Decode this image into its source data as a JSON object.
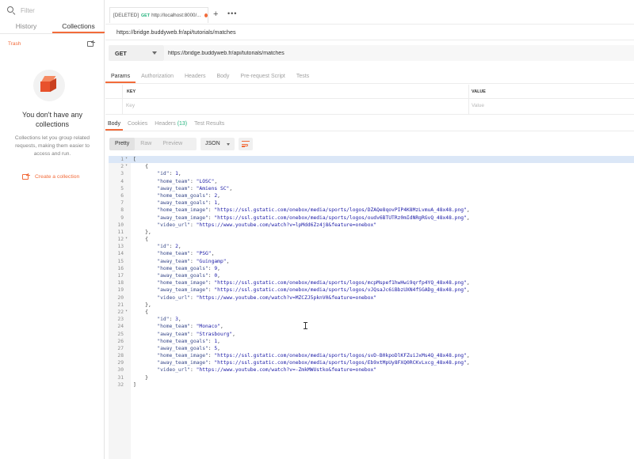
{
  "sidebar": {
    "filter_placeholder": "Filter",
    "tabs": [
      {
        "label": "History",
        "active": false
      },
      {
        "label": "Collections",
        "active": true
      }
    ],
    "trash_label": "Trash",
    "empty_title": "You don't have any collections",
    "empty_desc": "Collections let you group related requests, making them easier to access and run.",
    "create_label": "Create a collection"
  },
  "tab_strip": {
    "deleted_label": "[DELETED]",
    "method": "GET",
    "url": "http://localhost:8000/...",
    "plus": "+",
    "more": "•••"
  },
  "request": {
    "title": "https://bridge.buddyweb.fr/api/tutorials/matches",
    "method": "GET",
    "url": "https://bridge.buddyweb.fr/api/tutorials/matches"
  },
  "params_tabs": [
    "Params",
    "Authorization",
    "Headers",
    "Body",
    "Pre-request Script",
    "Tests"
  ],
  "kv_table": {
    "key_header": "KEY",
    "value_header": "VALUE",
    "key_placeholder": "Key",
    "value_placeholder": "Value"
  },
  "response_tabs": {
    "body": "Body",
    "cookies": "Cookies",
    "headers": "Headers",
    "headers_count": "(13)",
    "test_results": "Test Results"
  },
  "format": {
    "buttons": [
      "Pretty",
      "Raw",
      "Preview"
    ],
    "active": "Pretty",
    "language": "JSON"
  },
  "response_body": [
    {
      "ln": "1",
      "fold": true,
      "parts": [
        [
          "p",
          "["
        ]
      ]
    },
    {
      "ln": "2",
      "fold": true,
      "parts": [
        [
          "p",
          "    {"
        ]
      ]
    },
    {
      "ln": "3",
      "fold": false,
      "parts": [
        [
          "k",
          "        \"id\""
        ],
        [
          "p",
          ": "
        ],
        [
          "n",
          "1"
        ],
        [
          "p",
          ","
        ]
      ]
    },
    {
      "ln": "4",
      "fold": false,
      "parts": [
        [
          "k",
          "        \"home_team\""
        ],
        [
          "p",
          ": "
        ],
        [
          "s",
          "\"LOSC\""
        ],
        [
          "p",
          ","
        ]
      ]
    },
    {
      "ln": "5",
      "fold": false,
      "parts": [
        [
          "k",
          "        \"away_team\""
        ],
        [
          "p",
          ": "
        ],
        [
          "s",
          "\"Amiens SC\""
        ],
        [
          "p",
          ","
        ]
      ]
    },
    {
      "ln": "6",
      "fold": false,
      "parts": [
        [
          "k",
          "        \"home_team_goals\""
        ],
        [
          "p",
          ": "
        ],
        [
          "n",
          "2"
        ],
        [
          "p",
          ","
        ]
      ]
    },
    {
      "ln": "7",
      "fold": false,
      "parts": [
        [
          "k",
          "        \"away_team_goals\""
        ],
        [
          "p",
          ": "
        ],
        [
          "n",
          "1"
        ],
        [
          "p",
          ","
        ]
      ]
    },
    {
      "ln": "8",
      "fold": false,
      "parts": [
        [
          "k",
          "        \"home_team_image\""
        ],
        [
          "p",
          ": "
        ],
        [
          "s",
          "\"https://ssl.gstatic.com/onebox/media/sports/logos/DZAQe8qovPIP4K8MzLvmuA_48x48.png\""
        ],
        [
          "p",
          ","
        ]
      ]
    },
    {
      "ln": "9",
      "fold": false,
      "parts": [
        [
          "k",
          "        \"away_team_image\""
        ],
        [
          "p",
          ": "
        ],
        [
          "s",
          "\"https://ssl.gstatic.com/onebox/media/sports/logos/oudv6BTUTRz0mIdNRgRGvQ_48x48.png\""
        ],
        [
          "p",
          ","
        ]
      ]
    },
    {
      "ln": "10",
      "fold": false,
      "parts": [
        [
          "k",
          "        \"video_url\""
        ],
        [
          "p",
          ": "
        ],
        [
          "s",
          "\"https://www.youtube.com/watch?v=lpMdd6Zz4j8&feature=onebox\""
        ]
      ]
    },
    {
      "ln": "11",
      "fold": false,
      "parts": [
        [
          "p",
          "    },"
        ]
      ]
    },
    {
      "ln": "12",
      "fold": true,
      "parts": [
        [
          "p",
          "    {"
        ]
      ]
    },
    {
      "ln": "13",
      "fold": false,
      "parts": [
        [
          "k",
          "        \"id\""
        ],
        [
          "p",
          ": "
        ],
        [
          "n",
          "2"
        ],
        [
          "p",
          ","
        ]
      ]
    },
    {
      "ln": "14",
      "fold": false,
      "parts": [
        [
          "k",
          "        \"home_team\""
        ],
        [
          "p",
          ": "
        ],
        [
          "s",
          "\"PSG\""
        ],
        [
          "p",
          ","
        ]
      ]
    },
    {
      "ln": "15",
      "fold": false,
      "parts": [
        [
          "k",
          "        \"away_team\""
        ],
        [
          "p",
          ": "
        ],
        [
          "s",
          "\"Guingamp\""
        ],
        [
          "p",
          ","
        ]
      ]
    },
    {
      "ln": "16",
      "fold": false,
      "parts": [
        [
          "k",
          "        \"home_team_goals\""
        ],
        [
          "p",
          ": "
        ],
        [
          "n",
          "9"
        ],
        [
          "p",
          ","
        ]
      ]
    },
    {
      "ln": "17",
      "fold": false,
      "parts": [
        [
          "k",
          "        \"away_team_goals\""
        ],
        [
          "p",
          ": "
        ],
        [
          "n",
          "0"
        ],
        [
          "p",
          ","
        ]
      ]
    },
    {
      "ln": "18",
      "fold": false,
      "parts": [
        [
          "k",
          "        \"home_team_image\""
        ],
        [
          "p",
          ": "
        ],
        [
          "s",
          "\"https://ssl.gstatic.com/onebox/media/sports/logos/mcpMspef1hwHwi9qrfp4YQ_48x48.png\""
        ],
        [
          "p",
          ","
        ]
      ]
    },
    {
      "ln": "19",
      "fold": false,
      "parts": [
        [
          "k",
          "        \"away_team_image\""
        ],
        [
          "p",
          ": "
        ],
        [
          "s",
          "\"https://ssl.gstatic.com/onebox/media/sports/logos/vJQsaJc6iBbzUXN4fSGADg_48x48.png\""
        ],
        [
          "p",
          ","
        ]
      ]
    },
    {
      "ln": "20",
      "fold": false,
      "parts": [
        [
          "k",
          "        \"video_url\""
        ],
        [
          "p",
          ": "
        ],
        [
          "s",
          "\"https://www.youtube.com/watch?v=MZCZJ5pknV0&feature=onebox\""
        ]
      ]
    },
    {
      "ln": "21",
      "fold": false,
      "parts": [
        [
          "p",
          "    },"
        ]
      ]
    },
    {
      "ln": "22",
      "fold": true,
      "parts": [
        [
          "p",
          "    {"
        ]
      ]
    },
    {
      "ln": "23",
      "fold": false,
      "parts": [
        [
          "k",
          "        \"id\""
        ],
        [
          "p",
          ": "
        ],
        [
          "n",
          "3"
        ],
        [
          "p",
          ","
        ]
      ]
    },
    {
      "ln": "24",
      "fold": false,
      "parts": [
        [
          "k",
          "        \"home_team\""
        ],
        [
          "p",
          ": "
        ],
        [
          "s",
          "\"Monaco\""
        ],
        [
          "p",
          ","
        ]
      ]
    },
    {
      "ln": "25",
      "fold": false,
      "parts": [
        [
          "k",
          "        \"away_team\""
        ],
        [
          "p",
          ": "
        ],
        [
          "s",
          "\"Strasbourg\""
        ],
        [
          "p",
          ","
        ]
      ]
    },
    {
      "ln": "26",
      "fold": false,
      "parts": [
        [
          "k",
          "        \"home_team_goals\""
        ],
        [
          "p",
          ": "
        ],
        [
          "n",
          "1"
        ],
        [
          "p",
          ","
        ]
      ]
    },
    {
      "ln": "27",
      "fold": false,
      "parts": [
        [
          "k",
          "        \"away_team_goals\""
        ],
        [
          "p",
          ": "
        ],
        [
          "n",
          "5"
        ],
        [
          "p",
          ","
        ]
      ]
    },
    {
      "ln": "28",
      "fold": false,
      "parts": [
        [
          "k",
          "        \"home_team_image\""
        ],
        [
          "p",
          ": "
        ],
        [
          "s",
          "\"https://ssl.gstatic.com/onebox/media/sports/logos/svD-B0kpoDlKFZuiJxMs4Q_48x48.png\""
        ],
        [
          "p",
          ","
        ]
      ]
    },
    {
      "ln": "29",
      "fold": false,
      "parts": [
        [
          "k",
          "        \"away_team_image\""
        ],
        [
          "p",
          ": "
        ],
        [
          "s",
          "\"https://ssl.gstatic.com/onebox/media/sports/logos/Eb9xtMpUy8FXQ0RCKvLxcg_48x48.png\""
        ],
        [
          "p",
          ","
        ]
      ]
    },
    {
      "ln": "30",
      "fold": false,
      "parts": [
        [
          "k",
          "        \"video_url\""
        ],
        [
          "p",
          ": "
        ],
        [
          "s",
          "\"https://www.youtube.com/watch?v=-ZmkMWUstko&feature=onebox\""
        ]
      ]
    },
    {
      "ln": "31",
      "fold": false,
      "parts": [
        [
          "p",
          "    }"
        ]
      ]
    },
    {
      "ln": "32",
      "fold": false,
      "parts": [
        [
          "p",
          "]"
        ]
      ]
    }
  ],
  "colors": {
    "accent": "#f26b3a",
    "get_method": "#26b47f",
    "json_key": "#3a4a8a",
    "json_value": "#1a1aa6"
  }
}
